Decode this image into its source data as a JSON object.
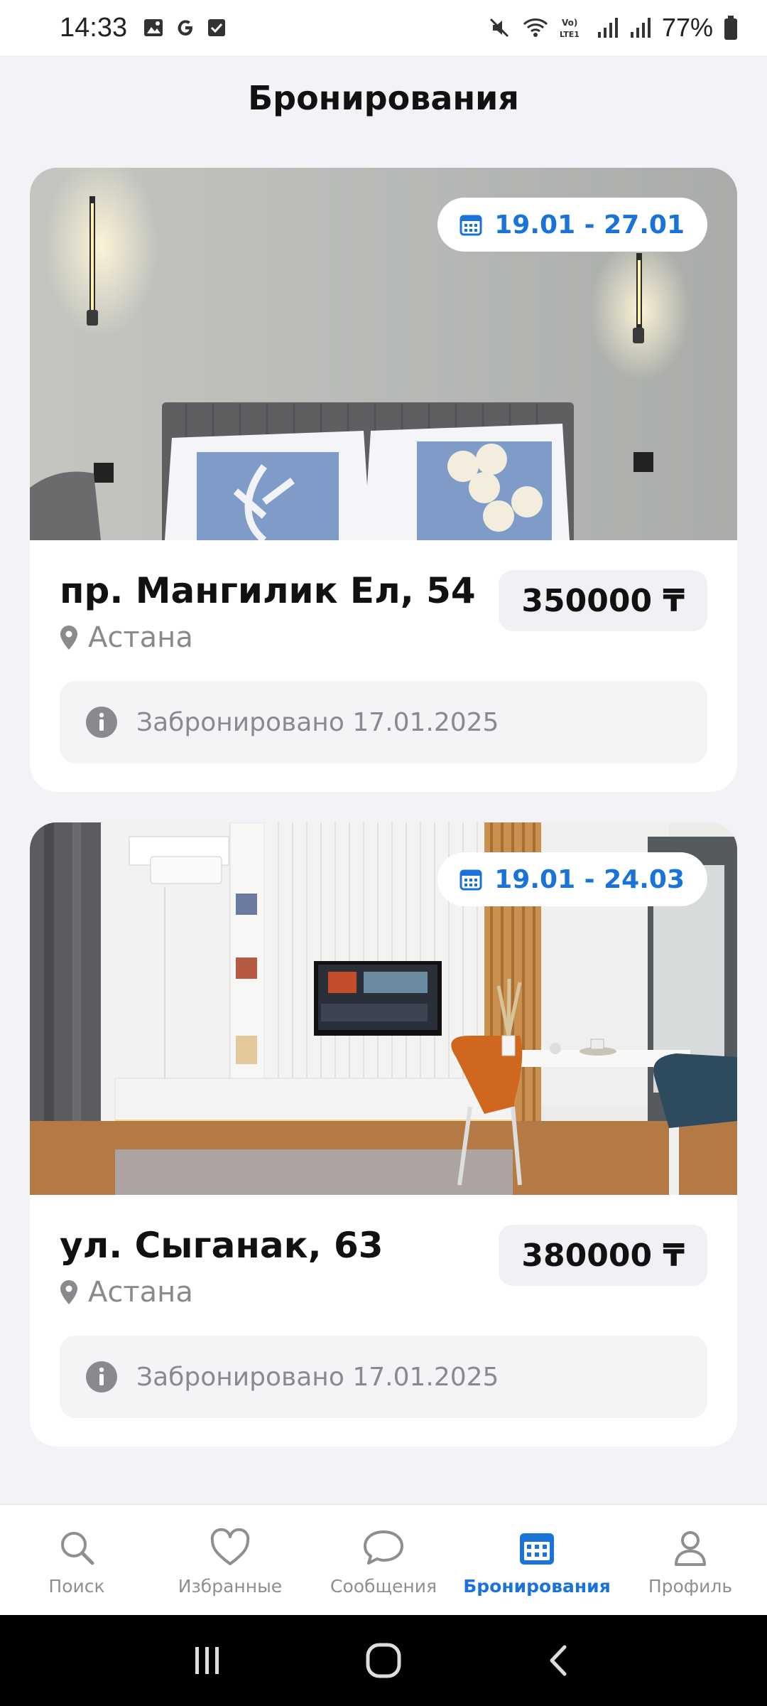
{
  "status_bar": {
    "time": "14:33",
    "battery": "77%",
    "icons": [
      "gallery-icon",
      "google-icon",
      "checkbox-icon",
      "mute-icon",
      "wifi-icon",
      "volte-icon",
      "signal-icon",
      "signal-icon",
      "battery-icon"
    ]
  },
  "header": {
    "title": "Бронирования"
  },
  "bookings": [
    {
      "dates": "19.01 - 27.01",
      "address": "пр. Мангилик Ел, 54",
      "price": "350000 ₸",
      "city": "Астана",
      "status": "Забронировано 17.01.2025"
    },
    {
      "dates": "19.01 - 24.03",
      "address": "ул. Сыганак, 63",
      "price": "380000 ₸",
      "city": "Астана",
      "status": "Забронировано 17.01.2025"
    }
  ],
  "nav": {
    "items": [
      {
        "label": "Поиск",
        "icon": "search-icon"
      },
      {
        "label": "Избранные",
        "icon": "heart-icon"
      },
      {
        "label": "Сообщения",
        "icon": "chat-bubble-icon"
      },
      {
        "label": "Бронирования",
        "icon": "calendar-icon"
      },
      {
        "label": "Профиль",
        "icon": "person-icon"
      }
    ],
    "active": "Бронирования"
  },
  "colors": {
    "accent": "#1a73d9",
    "background": "#f2f2f7",
    "muted": "#8a8a8e"
  }
}
